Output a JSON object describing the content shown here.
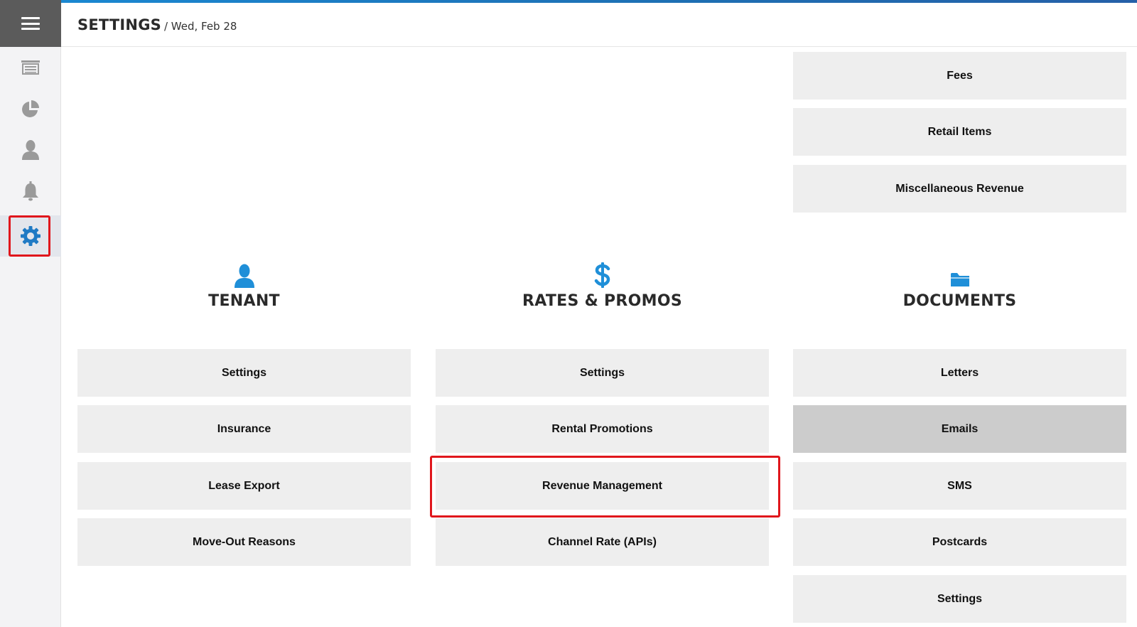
{
  "header": {
    "title": "SETTINGS",
    "date": "/ Wed, Feb 28"
  },
  "sidebar": {
    "items": [
      {
        "icon": "menu-icon"
      },
      {
        "icon": "list-icon"
      },
      {
        "icon": "pie-chart-icon"
      },
      {
        "icon": "user-icon"
      },
      {
        "icon": "bell-icon"
      },
      {
        "icon": "gear-icon",
        "active": true
      }
    ]
  },
  "top_tiles": [
    "Fees",
    "Retail Items",
    "Miscellaneous Revenue"
  ],
  "sections": [
    {
      "title": "TENANT",
      "icon": "user-icon",
      "tiles": [
        "Settings",
        "Insurance",
        "Lease Export",
        "Move-Out Reasons"
      ]
    },
    {
      "title": "RATES & PROMOS",
      "icon": "dollar-icon",
      "tiles": [
        "Settings",
        "Rental Promotions",
        "Revenue Management",
        "Channel Rate (APIs)"
      ]
    },
    {
      "title": "DOCUMENTS",
      "icon": "folder-icon",
      "tiles": [
        "Letters",
        "Emails",
        "SMS",
        "Postcards",
        "Settings"
      ]
    }
  ],
  "colors": {
    "accent": "#1a8ad4",
    "tile_bg": "#eeeeee",
    "tile_pressed_bg": "#cccccc",
    "highlight": "#e0161c"
  }
}
